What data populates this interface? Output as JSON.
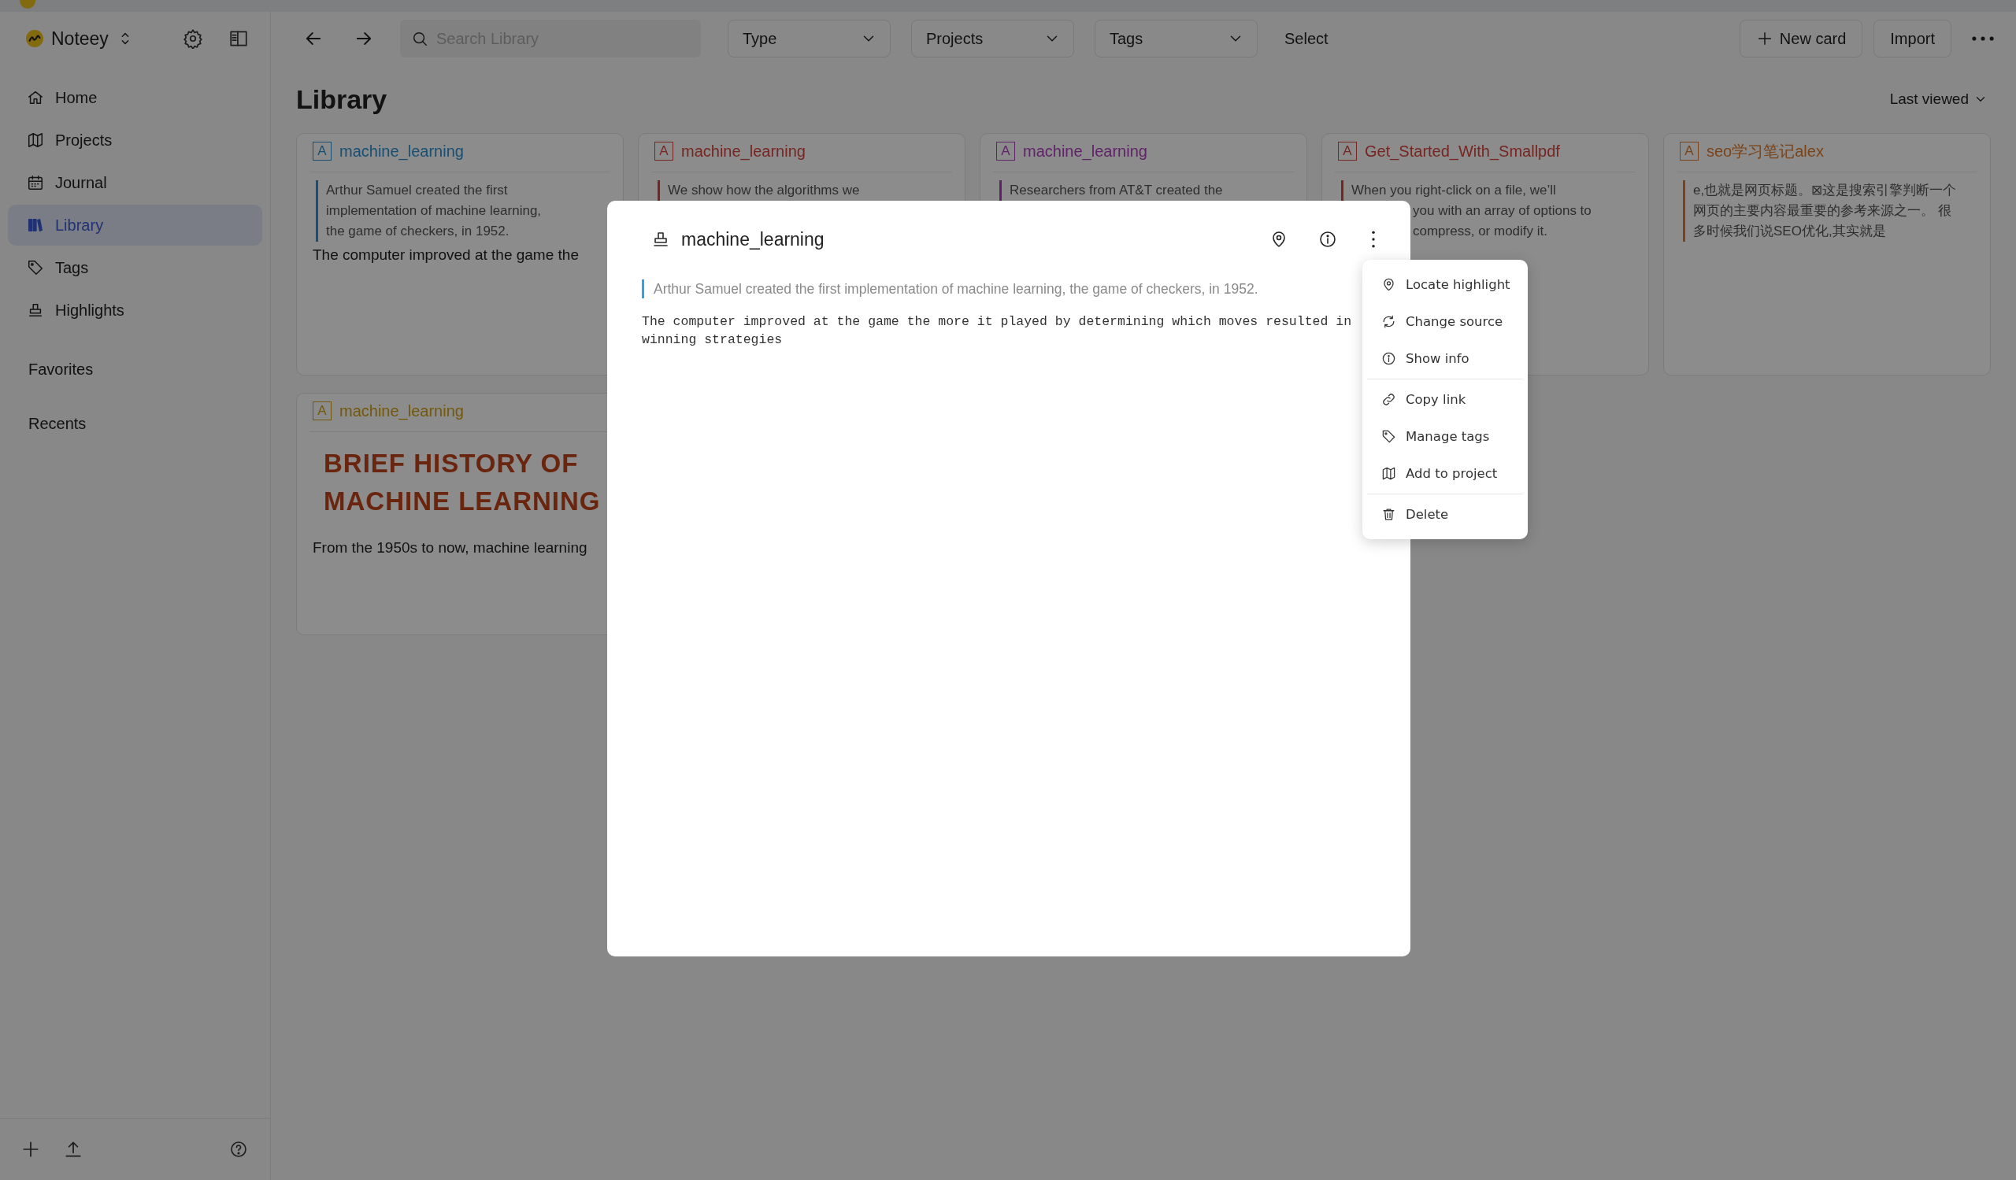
{
  "app": {
    "name": "Noteey"
  },
  "sidebar": {
    "nav": [
      {
        "label": "Home",
        "selected": false
      },
      {
        "label": "Projects",
        "selected": false
      },
      {
        "label": "Journal",
        "selected": false
      },
      {
        "label": "Library",
        "selected": true
      },
      {
        "label": "Tags",
        "selected": false
      },
      {
        "label": "Highlights",
        "selected": false
      }
    ],
    "sections": [
      "Favorites",
      "Recents"
    ]
  },
  "toolbar": {
    "search": {
      "placeholder": "Search Library"
    },
    "filters": [
      "Type",
      "Projects",
      "Tags"
    ],
    "select": "Select",
    "buttons": [
      {
        "label": "New card",
        "kind": "add"
      },
      {
        "label": "Import",
        "kind": "plain"
      }
    ]
  },
  "page": {
    "title": "Library",
    "sort": "Last viewed"
  },
  "cards": [
    {
      "badge": "A",
      "title": "machine_learning",
      "color": "#184f73",
      "quote": [
        "Arthur Samuel created the first",
        "implementation of machine learning,",
        "the game of checkers, in 1952."
      ],
      "body": "The computer improved at the game the"
    },
    {
      "badge": "A",
      "title": "machine_learning",
      "color": "#772622",
      "quote": [
        "We show how the algorithms we"
      ]
    },
    {
      "badge": "A",
      "title": "machine_learning",
      "color": "#612369",
      "quote": [
        "Researchers from AT&T created the"
      ]
    },
    {
      "badge": "A",
      "title": "Get_Started_With_Smallpdf",
      "color": "#772622",
      "quote": [
        "When you right-click on a file, we’ll"
      ],
      "cut_lines": [
        "you with an array of options to",
        "compress, or modify it."
      ]
    },
    {
      "badge": "A",
      "title": "seo学习笔记alex",
      "color": "#7b4317",
      "quote": [
        "e,也就是网页标题。⊠这是搜索引擎判断一个",
        "网页的主要内容最重要的参考来源之一。 很",
        "多时候我们说SEO优化,其实就是"
      ]
    },
    {
      "badge": "A",
      "title": "machine_learning",
      "color": "#74580a",
      "heading": "BRIEF HISTORY OF MACHINE LEARNING",
      "body": "From the 1950s to now, machine learning"
    }
  ],
  "modal": {
    "title": "machine_learning",
    "quote": "Arthur Samuel created the first implementation of machine learning, the game of checkers, in 1952.",
    "body": "The computer improved at the game the more it played by determining which moves resulted in winning strategies"
  },
  "menu": {
    "groups": [
      [
        "Locate highlight",
        "Change source",
        "Show info"
      ],
      [
        "Copy link",
        "Manage tags",
        "Add to project"
      ],
      [
        "Delete"
      ]
    ]
  }
}
